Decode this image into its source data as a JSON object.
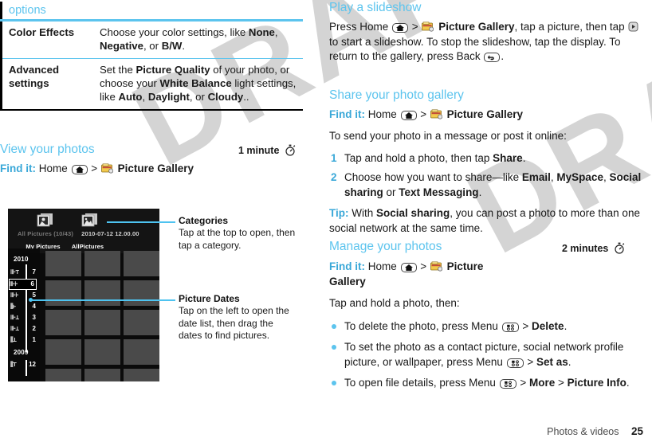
{
  "options_table": {
    "header": "options",
    "rows": [
      {
        "key": "Color Effects",
        "value_html": "Choose your color settings, like <b>None</b>, <b>Negative</b>, or <b>B/W</b>."
      },
      {
        "key": "Advanced settings",
        "value_html": "Set the <b>Picture Quality</b> of your photo, or choose your <b>White Balance</b> light settings, like <b>Auto</b>, <b>Daylight</b>, or <b>Cloudy</b>.."
      }
    ]
  },
  "left_column": {
    "view_photos": {
      "heading": "View your photos",
      "time_badge": "1 minute",
      "findit_label": "Find it:",
      "findit_html": "Home <span class=\"keycap\" data-name=\"home-key-icon\"><svg width=\"12\" height=\"10\" viewBox=\"0 0 12 10\"><path d=\"M6 1 L11 5 L9.6 5 L9.6 9 L2.4 9 L2.4 5 L1 5 Z\" fill=\"#111\"/></svg></span> &gt; <span class=\"icon-gallery\" data-name=\"picture-gallery-icon\"><svg width=\"15\" height=\"13\" viewBox=\"0 0 15 13\"><rect x=\"0.5\" y=\"2\" width=\"13\" height=\"9\" rx=\"1\" fill=\"#f2c94c\" stroke=\"#8a6d1a\" stroke-width=\"0.8\"/><rect x=\"2\" y=\"0.8\" width=\"7\" height=\"2.5\" fill=\"#f7e08a\" stroke=\"#8a6d1a\" stroke-width=\"0.6\"/><rect x=\"1.6\" y=\"4.2\" width=\"11\" height=\"2\" fill=\"#c24b3a\"/><circle cx=\"12.2\" cy=\"9.6\" r=\"2.6\" fill=\"#e6e6e6\" stroke=\"#6b6b6b\" stroke-width=\"0.8\"/></span> <b>Picture Gallery</b>"
    },
    "figure": {
      "categories": {
        "title": "Categories",
        "body": "Tap at the top to open, then tap a category."
      },
      "picture_dates": {
        "title": "Picture Dates",
        "body": "Tap on the left to open the date list, then drag the dates to find pictures."
      },
      "screenshot": {
        "tab_1_label": "My Pictures",
        "tab_2_label": "AllPictures",
        "meta_left": "All Pictures (10/43)",
        "meta_right": "2010-07-12  12.00.00",
        "year_2010": "2010",
        "year_2009": "2009",
        "months": [
          "7",
          "6",
          "5",
          "4",
          "3",
          "2",
          "1",
          "12"
        ],
        "selected_month": "6"
      }
    }
  },
  "right_column": {
    "slideshow": {
      "heading": "Play a slideshow",
      "body_html": "Press Home <span class=\"keycap\" data-name=\"home-key-icon\"><svg width=\"12\" height=\"10\" viewBox=\"0 0 12 10\"><path d=\"M6 1 L11 5 L9.6 5 L9.6 9 L2.4 9 L2.4 5 L1 5 Z\" fill=\"#111\"/></svg></span> &gt; <span class=\"icon-gallery\" data-name=\"picture-gallery-icon\"><svg width=\"15\" height=\"13\" viewBox=\"0 0 15 13\"><rect x=\"0.5\" y=\"2\" width=\"13\" height=\"9\" rx=\"1\" fill=\"#f2c94c\" stroke=\"#8a6d1a\" stroke-width=\"0.8\"/><rect x=\"2\" y=\"0.8\" width=\"7\" height=\"2.5\" fill=\"#f7e08a\" stroke=\"#8a6d1a\" stroke-width=\"0.6\"/><rect x=\"1.6\" y=\"4.2\" width=\"11\" height=\"2\" fill=\"#c24b3a\"/><circle cx=\"12.2\" cy=\"9.6\" r=\"2.6\" fill=\"#e6e6e6\" stroke=\"#6b6b6b\" stroke-width=\"0.8\"/></span> <b>Picture Gallery</b>, tap a picture, then tap <span class=\"icon-slideshow\" data-name=\"slideshow-icon\"><svg width=\"13\" height=\"13\" viewBox=\"0 0 13 13\"><rect x=\"1\" y=\"1\" width=\"11\" height=\"11\" rx=\"3\" fill=\"#d9d9d9\" stroke=\"#666\" stroke-width=\"1\"/><path d=\"M5 4 L9 6.5 L5 9 Z\" fill=\"#333\"/></svg></span> to start a slideshow. To stop the slideshow, tap the display. To return to the gallery, press Back <span class=\"keycap\" data-name=\"back-key-icon\"><svg width=\"12\" height=\"10\" viewBox=\"0 0 12 10\"><path d=\"M3.2 2.2 L3.2 4.4 L7.4 4.4 A2 2 0 0 1 7.4 8.2 L4.6 8.2 L4.6 6.6 L7.2 6.6 A0.6 0.6 0 0 0 7.2 5.8 L3.2 5.8 L3.2 7.8 L0.8 5 Z\" fill=\"#111\"/></svg></span>."
    },
    "share": {
      "heading": "Share your photo gallery",
      "findit_label": "Find it:",
      "findit_html": "Home <span class=\"keycap\" data-name=\"home-key-icon\"><svg width=\"12\" height=\"10\" viewBox=\"0 0 12 10\"><path d=\"M6 1 L11 5 L9.6 5 L9.6 9 L2.4 9 L2.4 5 L1 5 Z\" fill=\"#111\"/></svg></span> &gt; <span class=\"icon-gallery\" data-name=\"picture-gallery-icon\"><svg width=\"15\" height=\"13\" viewBox=\"0 0 15 13\"><rect x=\"0.5\" y=\"2\" width=\"13\" height=\"9\" rx=\"1\" fill=\"#f2c94c\" stroke=\"#8a6d1a\" stroke-width=\"0.8\"/><rect x=\"2\" y=\"0.8\" width=\"7\" height=\"2.5\" fill=\"#f7e08a\" stroke=\"#8a6d1a\" stroke-width=\"0.6\"/><rect x=\"1.6\" y=\"4.2\" width=\"11\" height=\"2\" fill=\"#c24b3a\"/><circle cx=\"12.2\" cy=\"9.6\" r=\"2.6\" fill=\"#e6e6e6\" stroke=\"#6b6b6b\" stroke-width=\"0.8\"/></span> <b>Picture Gallery</b>",
      "intro": "To send your photo in a message or post it online:",
      "steps": [
        {
          "num": "1",
          "html": "Tap and hold a photo, then tap <b>Share</b>."
        },
        {
          "num": "2",
          "html": "Choose how you want to share—like <b>Email</b>, <b>MySpace</b>, <b>Social sharing</b> or <b>Text Messaging</b>."
        }
      ],
      "tip_label": "Tip:",
      "tip_html": " With <b>Social sharing</b>, you can post a photo to more than one social network at the same time."
    },
    "manage": {
      "heading": "Manage your photos",
      "time_badge": "2 minutes",
      "findit_label": "Find it:",
      "findit_html": "Home <span class=\"keycap\" data-name=\"home-key-icon\"><svg width=\"12\" height=\"10\" viewBox=\"0 0 12 10\"><path d=\"M6 1 L11 5 L9.6 5 L9.6 9 L2.4 9 L2.4 5 L1 5 Z\" fill=\"#111\"/></svg></span> &gt; <span class=\"icon-gallery\" data-name=\"picture-gallery-icon\"><svg width=\"15\" height=\"13\" viewBox=\"0 0 15 13\"><rect x=\"0.5\" y=\"2\" width=\"13\" height=\"9\" rx=\"1\" fill=\"#f2c94c\" stroke=\"#8a6d1a\" stroke-width=\"0.8\"/><rect x=\"2\" y=\"0.8\" width=\"7\" height=\"2.5\" fill=\"#f7e08a\" stroke=\"#8a6d1a\" stroke-width=\"0.6\"/><rect x=\"1.6\" y=\"4.2\" width=\"11\" height=\"2\" fill=\"#c24b3a\"/><circle cx=\"12.2\" cy=\"9.6\" r=\"2.6\" fill=\"#e6e6e6\" stroke=\"#6b6b6b\" stroke-width=\"0.8\"/></span> <b>Picture</b>",
      "findit_cont": "Gallery",
      "intro": "Tap and hold a photo, then:",
      "bullets": [
        {
          "html": "To delete the photo, press Menu <span class=\"keycap\" data-name=\"menu-key-icon\"><svg width=\"13\" height=\"10\" viewBox=\"0 0 13 10\"><rect x=\"2.2\" y=\"1.8\" width=\"3.4\" height=\"3\" fill=\"#111\"/><circle cx=\"9\" cy=\"3.2\" r=\"1.4\" fill=\"none\" stroke=\"#111\" stroke-width=\"0.9\"/><circle cx=\"3.9\" cy=\"7.2\" r=\"1.4\" fill=\"none\" stroke=\"#111\" stroke-width=\"0.9\"/><circle cx=\"9\" cy=\"7.2\" r=\"1.4\" fill=\"none\" stroke=\"#111\" stroke-width=\"0.9\"/></svg></span> &gt; <b>Delete</b>."
        },
        {
          "html": "To set the photo as a contact picture, social network profile picture, or wallpaper, press Menu <span class=\"keycap\" data-name=\"menu-key-icon\"><svg width=\"13\" height=\"10\" viewBox=\"0 0 13 10\"><rect x=\"2.2\" y=\"1.8\" width=\"3.4\" height=\"3\" fill=\"#111\"/><circle cx=\"9\" cy=\"3.2\" r=\"1.4\" fill=\"none\" stroke=\"#111\" stroke-width=\"0.9\"/><circle cx=\"3.9\" cy=\"7.2\" r=\"1.4\" fill=\"none\" stroke=\"#111\" stroke-width=\"0.9\"/><circle cx=\"9\" cy=\"7.2\" r=\"1.4\" fill=\"none\" stroke=\"#111\" stroke-width=\"0.9\"/></svg></span> &gt; <b>Set as</b>."
        },
        {
          "html": "To open file details, press Menu <span class=\"keycap\" data-name=\"menu-key-icon\"><svg width=\"13\" height=\"10\" viewBox=\"0 0 13 10\"><rect x=\"2.2\" y=\"1.8\" width=\"3.4\" height=\"3\" fill=\"#111\"/><circle cx=\"9\" cy=\"3.2\" r=\"1.4\" fill=\"none\" stroke=\"#111\" stroke-width=\"0.9\"/><circle cx=\"3.9\" cy=\"7.2\" r=\"1.4\" fill=\"none\" stroke=\"#111\" stroke-width=\"0.9\"/><circle cx=\"9\" cy=\"7.2\" r=\"1.4\" fill=\"none\" stroke=\"#111\" stroke-width=\"0.9\"/></svg></span> &gt; <b>More</b> &gt; <b>Picture Info</b>."
        }
      ]
    }
  },
  "footer": {
    "section": "Photos & videos",
    "page_number": "25"
  },
  "watermark": {
    "text": "DRAFT"
  },
  "colors": {
    "accent_blue": "#5cc4ee",
    "heading_blue": "#3aa8d8",
    "text_black": "#1a1a1a",
    "gallery_icon_yellow": "#f2c94c"
  }
}
